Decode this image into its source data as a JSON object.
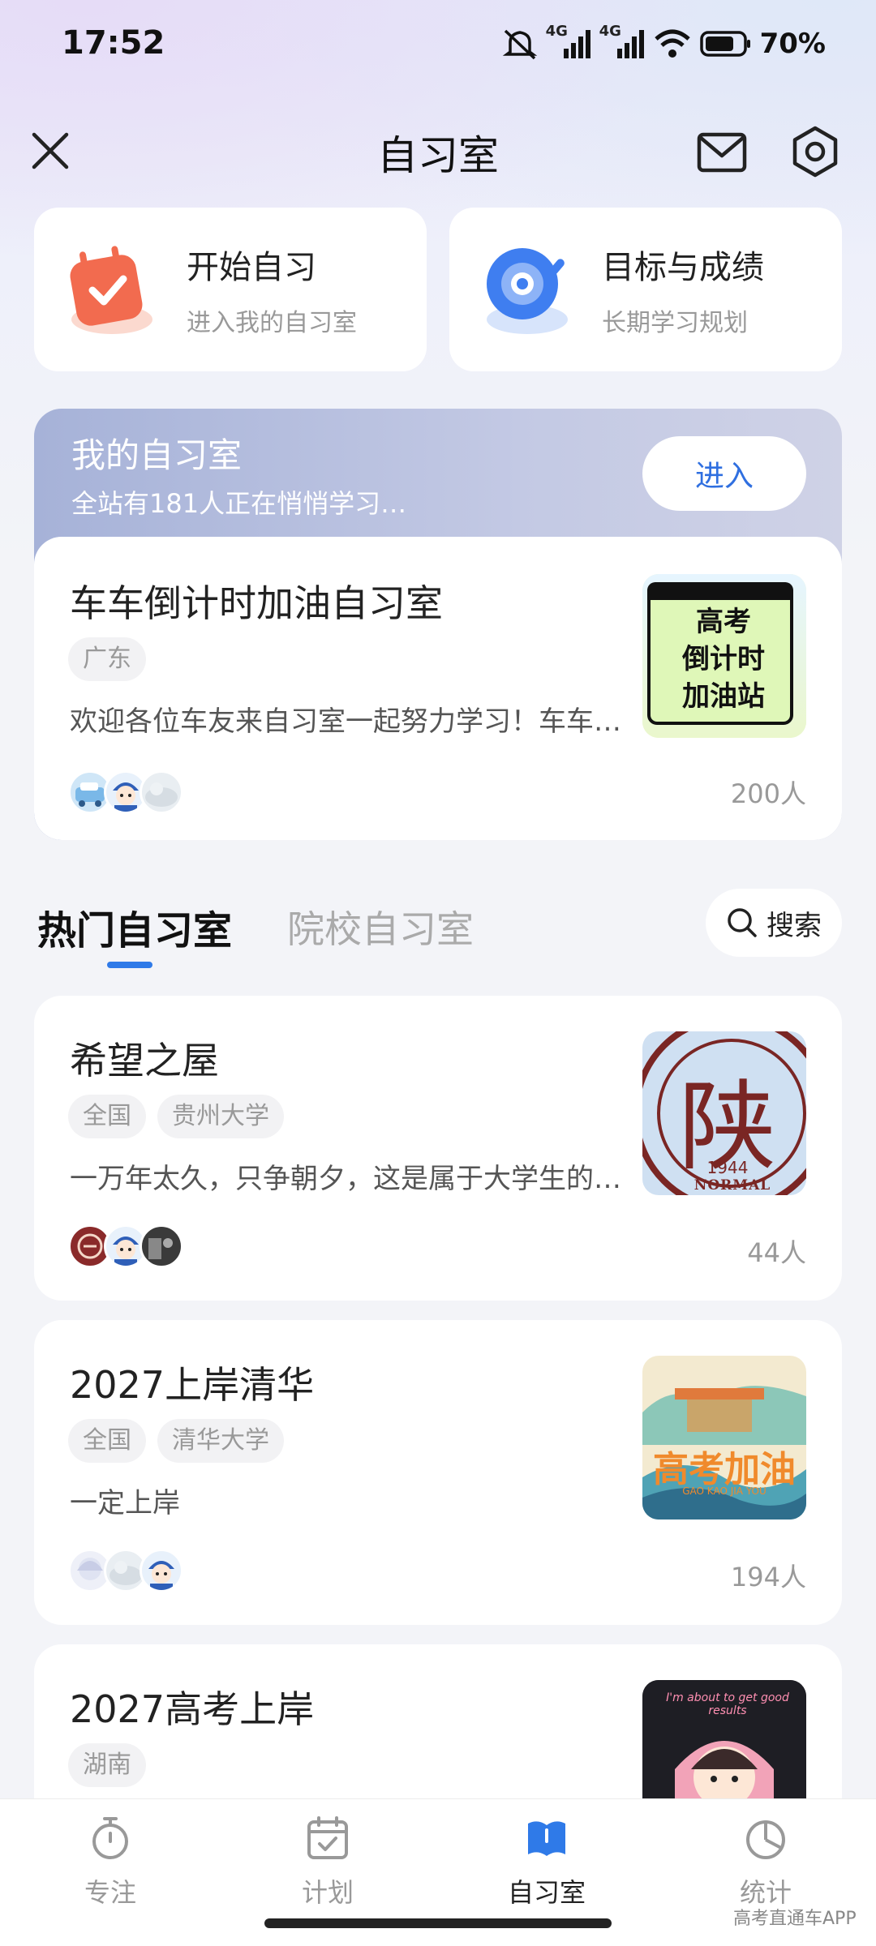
{
  "status_bar": {
    "time": "17:52",
    "net1": "4G",
    "net2": "4G",
    "battery": "70%"
  },
  "header": {
    "title": "自习室",
    "close_icon": "close-icon",
    "mail_icon": "mail-icon",
    "settings_icon": "settings-icon"
  },
  "quick_actions": [
    {
      "title": "开始自习",
      "subtitle": "进入我的自习室",
      "icon": "calendar-check-icon",
      "color": "#f26b4f"
    },
    {
      "title": "目标与成绩",
      "subtitle": "长期学习规划",
      "icon": "target-icon",
      "color": "#3f7ef0"
    }
  ],
  "my_room": {
    "title": "我的自习室",
    "subtitle": "全站有181人正在悄悄学习…",
    "enter_label": "进入",
    "room": {
      "name": "车车倒计时加油自习室",
      "tags": [
        "广东"
      ],
      "description": "欢迎各位车友来自习室一起努力学习！车车…",
      "count": "200人",
      "thumb_text": [
        "高考",
        "倒计时",
        "加油站"
      ]
    }
  },
  "tabs": {
    "hot": "热门自习室",
    "school": "院校自习室",
    "search_label": "搜索"
  },
  "rooms": [
    {
      "name": "希望之屋",
      "tags": [
        "全国",
        "贵州大学"
      ],
      "description": "一万年太久，只争朝夕，这是属于大学生的…",
      "count": "44人",
      "thumb_text": "陕",
      "thumb_year": "1944",
      "thumb_arc": "NORMAL UNIVERSITY"
    },
    {
      "name": "2027上岸清华",
      "tags": [
        "全国",
        "清华大学"
      ],
      "description": "一定上岸",
      "count": "194人",
      "thumb_text": "高考加油",
      "thumb_sub": "GAO KAO JIA YOU"
    },
    {
      "name": "2027高考上岸",
      "tags": [
        "湖南"
      ],
      "description": "",
      "count": "",
      "thumb_text": "I'm about to get good results"
    }
  ],
  "bottom_nav": [
    {
      "label": "专注",
      "icon": "timer-icon",
      "active": false
    },
    {
      "label": "计划",
      "icon": "calendar-icon",
      "active": false
    },
    {
      "label": "自习室",
      "icon": "book-icon",
      "active": true
    },
    {
      "label": "统计",
      "icon": "pie-chart-icon",
      "active": false
    }
  ],
  "watermark": "高考直通车APP",
  "colors": {
    "accent": "#2f7ae8",
    "enter_text": "#2f6fe0"
  }
}
